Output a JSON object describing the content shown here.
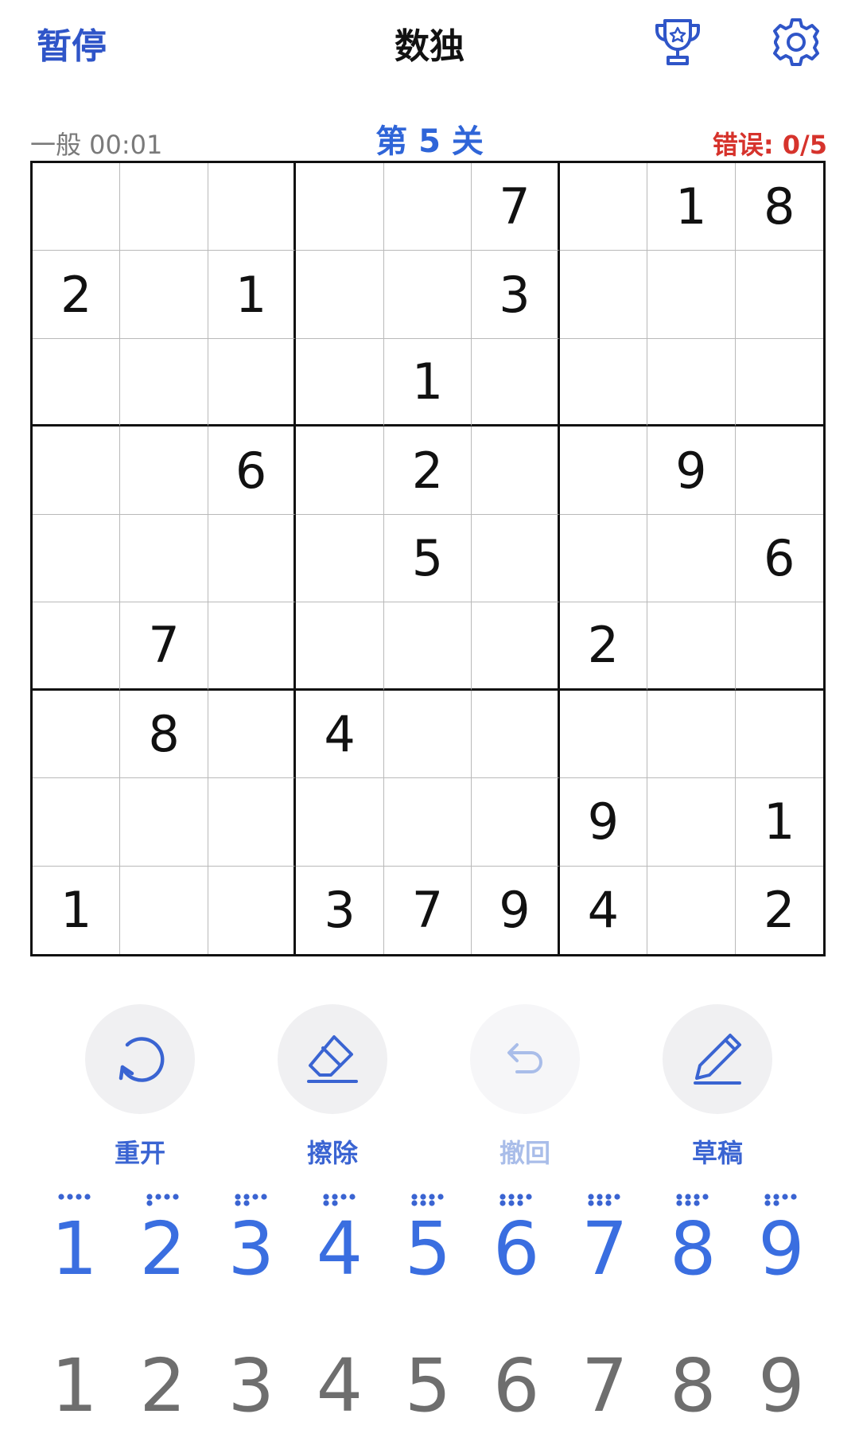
{
  "header": {
    "pause_label": "暂停",
    "title": "数独",
    "trophy_icon": "trophy-icon",
    "settings_icon": "gear-icon"
  },
  "status": {
    "difficulty_time": "一般 00:01",
    "level": "第 5 关",
    "errors": "错误: 0/5"
  },
  "board": [
    [
      "",
      "",
      "",
      "",
      "",
      "7",
      "",
      "1",
      "8"
    ],
    [
      "2",
      "",
      "1",
      "",
      "",
      "3",
      "",
      "",
      ""
    ],
    [
      "",
      "",
      "",
      "",
      "1",
      "",
      "",
      "",
      ""
    ],
    [
      "",
      "",
      "6",
      "",
      "2",
      "",
      "",
      "9",
      ""
    ],
    [
      "",
      "",
      "",
      "",
      "5",
      "",
      "",
      "",
      "6"
    ],
    [
      "",
      "7",
      "",
      "",
      "",
      "",
      "2",
      "",
      ""
    ],
    [
      "",
      "8",
      "",
      "4",
      "",
      "",
      "",
      "",
      ""
    ],
    [
      "",
      "",
      "",
      "",
      "",
      "",
      "9",
      "",
      "1"
    ],
    [
      "1",
      "",
      "",
      "3",
      "7",
      "9",
      "4",
      "",
      "2"
    ]
  ],
  "tools": [
    {
      "label": "重开",
      "icon": "restart-icon",
      "enabled": true
    },
    {
      "label": "擦除",
      "icon": "eraser-icon",
      "enabled": true
    },
    {
      "label": "撤回",
      "icon": "undo-icon",
      "enabled": false
    },
    {
      "label": "草稿",
      "icon": "pencil-icon",
      "enabled": true
    }
  ],
  "input_numbers": [
    "1",
    "2",
    "3",
    "4",
    "5",
    "6",
    "7",
    "8",
    "9"
  ],
  "remaining_counts": [
    4,
    5,
    6,
    6,
    7,
    7,
    7,
    7,
    6
  ],
  "note_numbers": [
    "1",
    "2",
    "3",
    "4",
    "5",
    "6",
    "7",
    "8",
    "9"
  ],
  "colors": {
    "accent": "#2f65d8",
    "error": "#d6332c",
    "grid_thick": "#111111",
    "grid_thin": "#b9b9b9"
  }
}
